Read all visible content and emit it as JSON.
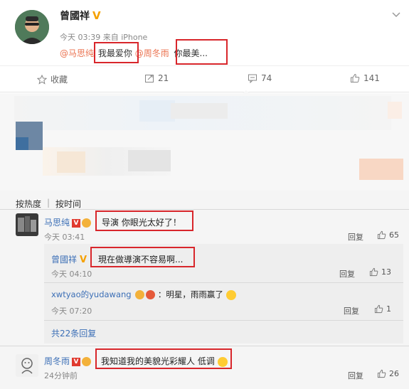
{
  "post": {
    "author": "曾國祥",
    "verified_mark": "V",
    "timestamp": "今天 03:39 来自 iPhone",
    "text_mention1": "@马思纯",
    "text_part1": "我最爱你",
    "text_mention2": "@周冬雨",
    "text_part2": "你最美..."
  },
  "actions": {
    "favorite": "收藏",
    "repost_count": "21",
    "comment_count": "74",
    "like_count": "141"
  },
  "sort": {
    "by_hot": "按热度",
    "by_time": "按时间"
  },
  "comments": [
    {
      "author": "马思纯",
      "badge": "V",
      "text": "导演 你眼光太好了！",
      "time": "今天 03:41",
      "reply_label": "回复",
      "likes": "65"
    },
    {
      "author": "周冬雨",
      "badge": "V",
      "text": "我知道我的美貌光彩耀人 低调",
      "time": "24分钟前",
      "reply_label": "回复",
      "likes": "26"
    }
  ],
  "replies": [
    {
      "author": "曾國祥",
      "verified_mark": "V",
      "separator": ":",
      "text": "現在做導演不容易啊...",
      "time": "今天 04:10",
      "reply_label": "回复",
      "likes": "13"
    },
    {
      "author": "xwtyao的yudawang",
      "text": "：明星，雨雨赢了",
      "time": "今天 07:20",
      "reply_label": "回复",
      "likes": "1"
    }
  ],
  "more_replies": "共22条回复",
  "colors": {
    "highlight_box": "#d8262b",
    "link_blue": "#3c6fb6",
    "mention_orange": "#eb7350",
    "verified_gold": "#f5a100"
  }
}
